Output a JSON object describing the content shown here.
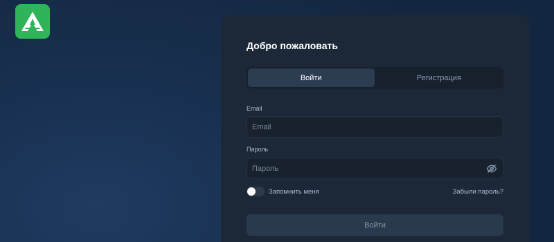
{
  "brand": {
    "logo_icon": "triangle-a-logo",
    "color": "#2fb45a"
  },
  "card": {
    "title": "Добро пожаловать",
    "tabs": [
      {
        "label": "Войти",
        "active": true
      },
      {
        "label": "Регистрация",
        "active": false
      }
    ],
    "email": {
      "label": "Email",
      "placeholder": "Email",
      "value": ""
    },
    "password": {
      "label": "Пароль",
      "placeholder": "Пароль",
      "value": "",
      "visibility_icon": "eye-off-icon"
    },
    "remember": {
      "label": "Запомнить меня",
      "checked": false
    },
    "forgot_label": "Забыли пароль?",
    "submit_label": "Войти"
  }
}
